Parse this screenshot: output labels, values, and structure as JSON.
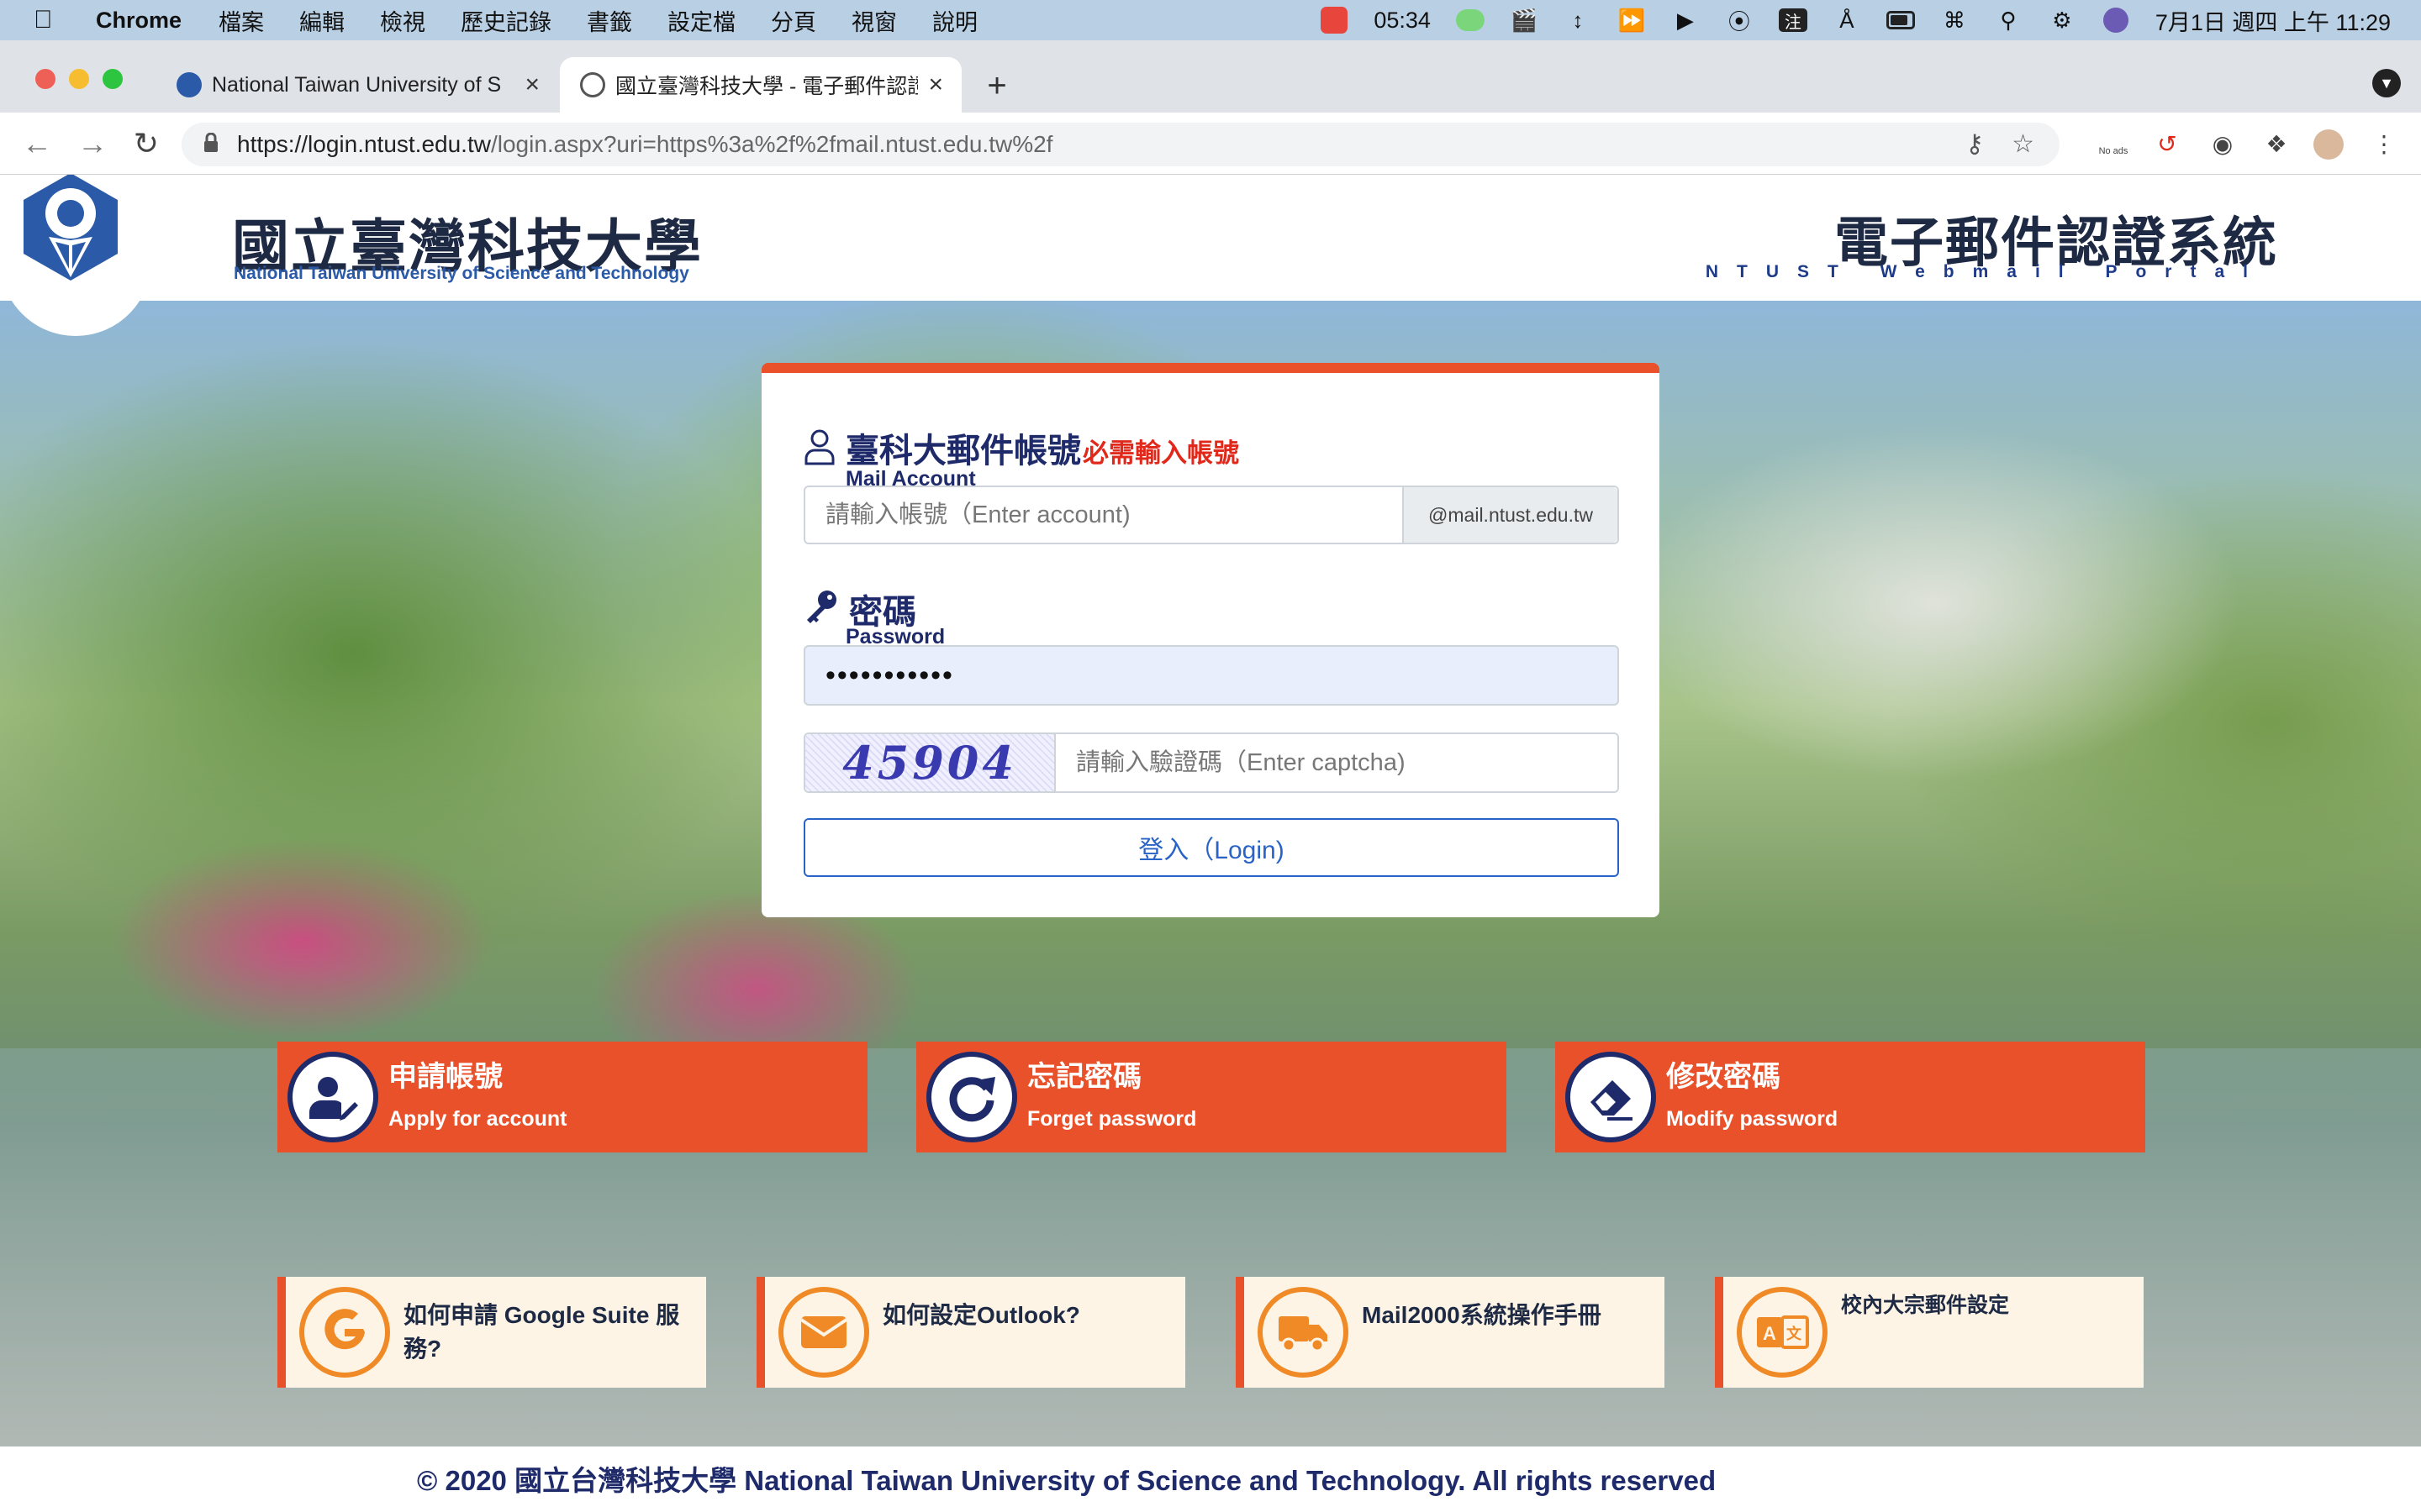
{
  "menubar": {
    "app_name": "Chrome",
    "items": [
      "檔案",
      "編輯",
      "檢視",
      "歷史記錄",
      "書籤",
      "設定檔",
      "分頁",
      "視窗",
      "說明"
    ],
    "clock_timer": "05:34",
    "datetime": "7月1日 週四 上午 11:29"
  },
  "browser": {
    "tabs": [
      {
        "title": "National Taiwan University of S",
        "active": false
      },
      {
        "title": "國立臺灣科技大學 - 電子郵件認證",
        "active": true
      }
    ],
    "url_host": "https://login.ntust.edu.tw",
    "url_path": "/login.aspx?uri=https%3a%2f%2fmail.ntust.edu.tw%2f",
    "ext_no_ads_label": "No ads"
  },
  "header": {
    "university_cn": "國立臺灣科技大學",
    "university_en": "National Taiwan University of Science and Technology",
    "portal_cn": "電子郵件認證系統",
    "portal_en": "NTUST Webmail Portal"
  },
  "login": {
    "account_label_cn": "臺科大郵件帳號",
    "account_required": "必需輸入帳號",
    "account_label_en": "Mail Account",
    "account_placeholder": "請輸入帳號（Enter account)",
    "account_suffix": "@mail.ntust.edu.tw",
    "password_label_cn": "密碼",
    "password_label_en": "Password",
    "password_value": "•••••••••••",
    "captcha_text": "45904",
    "captcha_placeholder": "請輸入驗證碼（Enter captcha)",
    "login_button": "登入（Login)"
  },
  "actions": [
    {
      "title": "申請帳號",
      "subtitle": "Apply for account",
      "icon": "user-edit-icon"
    },
    {
      "title": "忘記密碼",
      "subtitle": "Forget password",
      "icon": "redo-icon"
    },
    {
      "title": "修改密碼",
      "subtitle": "Modify password",
      "icon": "eraser-icon"
    }
  ],
  "help_links": [
    {
      "label": "如何申請 Google Suite 服務?",
      "icon": "google-icon"
    },
    {
      "label": "如何設定Outlook?",
      "icon": "envelope-icon"
    },
    {
      "label": "Mail2000系統操作手冊",
      "icon": "truck-icon"
    },
    {
      "label": "校內大宗郵件設定",
      "icon": "translate-icon"
    }
  ],
  "footer": {
    "copyright": "© 2020 國立台灣科技大學 National Taiwan University of Science and Technology. All rights reserved"
  },
  "colors": {
    "accent_orange": "#e8512a",
    "navy": "#1e2a6a",
    "link_blue": "#2a63c8",
    "help_bg": "#fdf4e6"
  }
}
